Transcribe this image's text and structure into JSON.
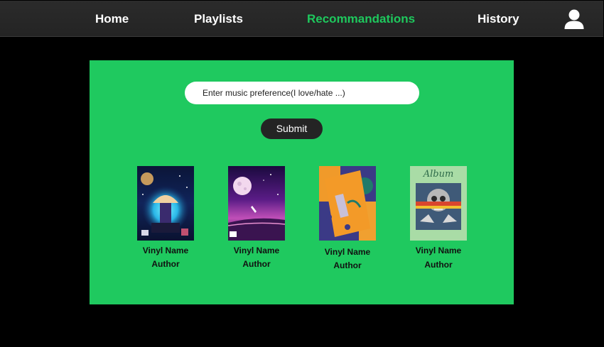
{
  "nav": {
    "items": [
      {
        "label": "Home"
      },
      {
        "label": "Playlists"
      },
      {
        "label": "Recommandations"
      },
      {
        "label": "History"
      }
    ],
    "active_color": "#1ec85d",
    "profile_icon": "user-icon"
  },
  "main": {
    "background": "#1fc95f",
    "preference_input": {
      "value": "",
      "placeholder": "Enter music preference(I love/hate ...)"
    },
    "submit_label": "Submit",
    "vinyls": [
      {
        "name": "Vinyl Name",
        "author": "Author"
      },
      {
        "name": "Vinyl Name",
        "author": "Author"
      },
      {
        "name": "Vinyl Name",
        "author": "Author"
      },
      {
        "name": "Vinyl Name",
        "author": "Author"
      }
    ],
    "album_cover_text": "Album"
  }
}
